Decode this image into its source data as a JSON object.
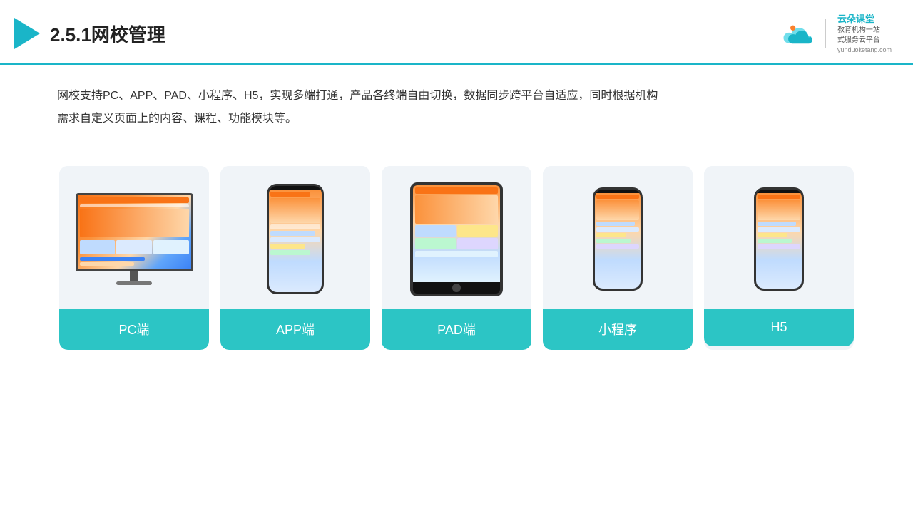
{
  "header": {
    "title": "2.5.1网校管理",
    "brand_name": "云朵课堂",
    "brand_url": "yunduoketang.com",
    "brand_tagline": "教育机构一站",
    "brand_tagline2": "式服务云平台"
  },
  "description": {
    "text1": "网校支持PC、APP、PAD、小程序、H5，实现多端打通，产品各终端自由切换，数据同步跨平台自适应，同时根据机构",
    "text2": "需求自定义页面上的内容、课程、功能模块等。"
  },
  "cards": [
    {
      "id": "pc",
      "label": "PC端"
    },
    {
      "id": "app",
      "label": "APP端"
    },
    {
      "id": "pad",
      "label": "PAD端"
    },
    {
      "id": "miniprogram",
      "label": "小程序"
    },
    {
      "id": "h5",
      "label": "H5"
    }
  ],
  "colors": {
    "accent": "#1ab5c8",
    "card_label_bg": "#2cc5c5"
  }
}
